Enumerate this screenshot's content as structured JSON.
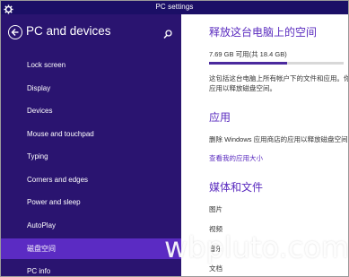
{
  "window": {
    "title": "PC settings",
    "app_icon": "gear-icon"
  },
  "left_pane": {
    "header_title": "PC and devices",
    "back_icon": "back-arrow-icon",
    "search_icon": "search-icon",
    "items": [
      {
        "label": "Lock screen",
        "selected": false
      },
      {
        "label": "Display",
        "selected": false
      },
      {
        "label": "Devices",
        "selected": false
      },
      {
        "label": "Mouse and touchpad",
        "selected": false
      },
      {
        "label": "Typing",
        "selected": false
      },
      {
        "label": "Corners and edges",
        "selected": false
      },
      {
        "label": "Power and sleep",
        "selected": false
      },
      {
        "label": "AutoPlay",
        "selected": false
      },
      {
        "label": "磁盘空间",
        "selected": true
      },
      {
        "label": "PC info",
        "selected": false
      }
    ]
  },
  "right_pane": {
    "heading": "释放这台电脑上的空间",
    "storage_text": "7.69 GB 可用(共 18.4 GB)",
    "storage_fraction": 0.58,
    "description_lines": [
      "这包括这台电脑上所有帐户下的文件和应用。你",
      "应用以释放磁盘空间。"
    ],
    "apps_heading": "应用",
    "apps_description": "删除 Windows 应用商店的应用以释放磁盘空间",
    "apps_link": "查看我的应用大小",
    "media_heading": "媒体和文件",
    "media_items": [
      "图片",
      "视频",
      "音乐",
      "文档"
    ]
  },
  "watermark": "wbpluto.com",
  "colors": {
    "titlebar": "#1b0f66",
    "left_pane": "#2a1470",
    "selected_item": "#5b2bc3",
    "accent": "#5a2bbf"
  }
}
